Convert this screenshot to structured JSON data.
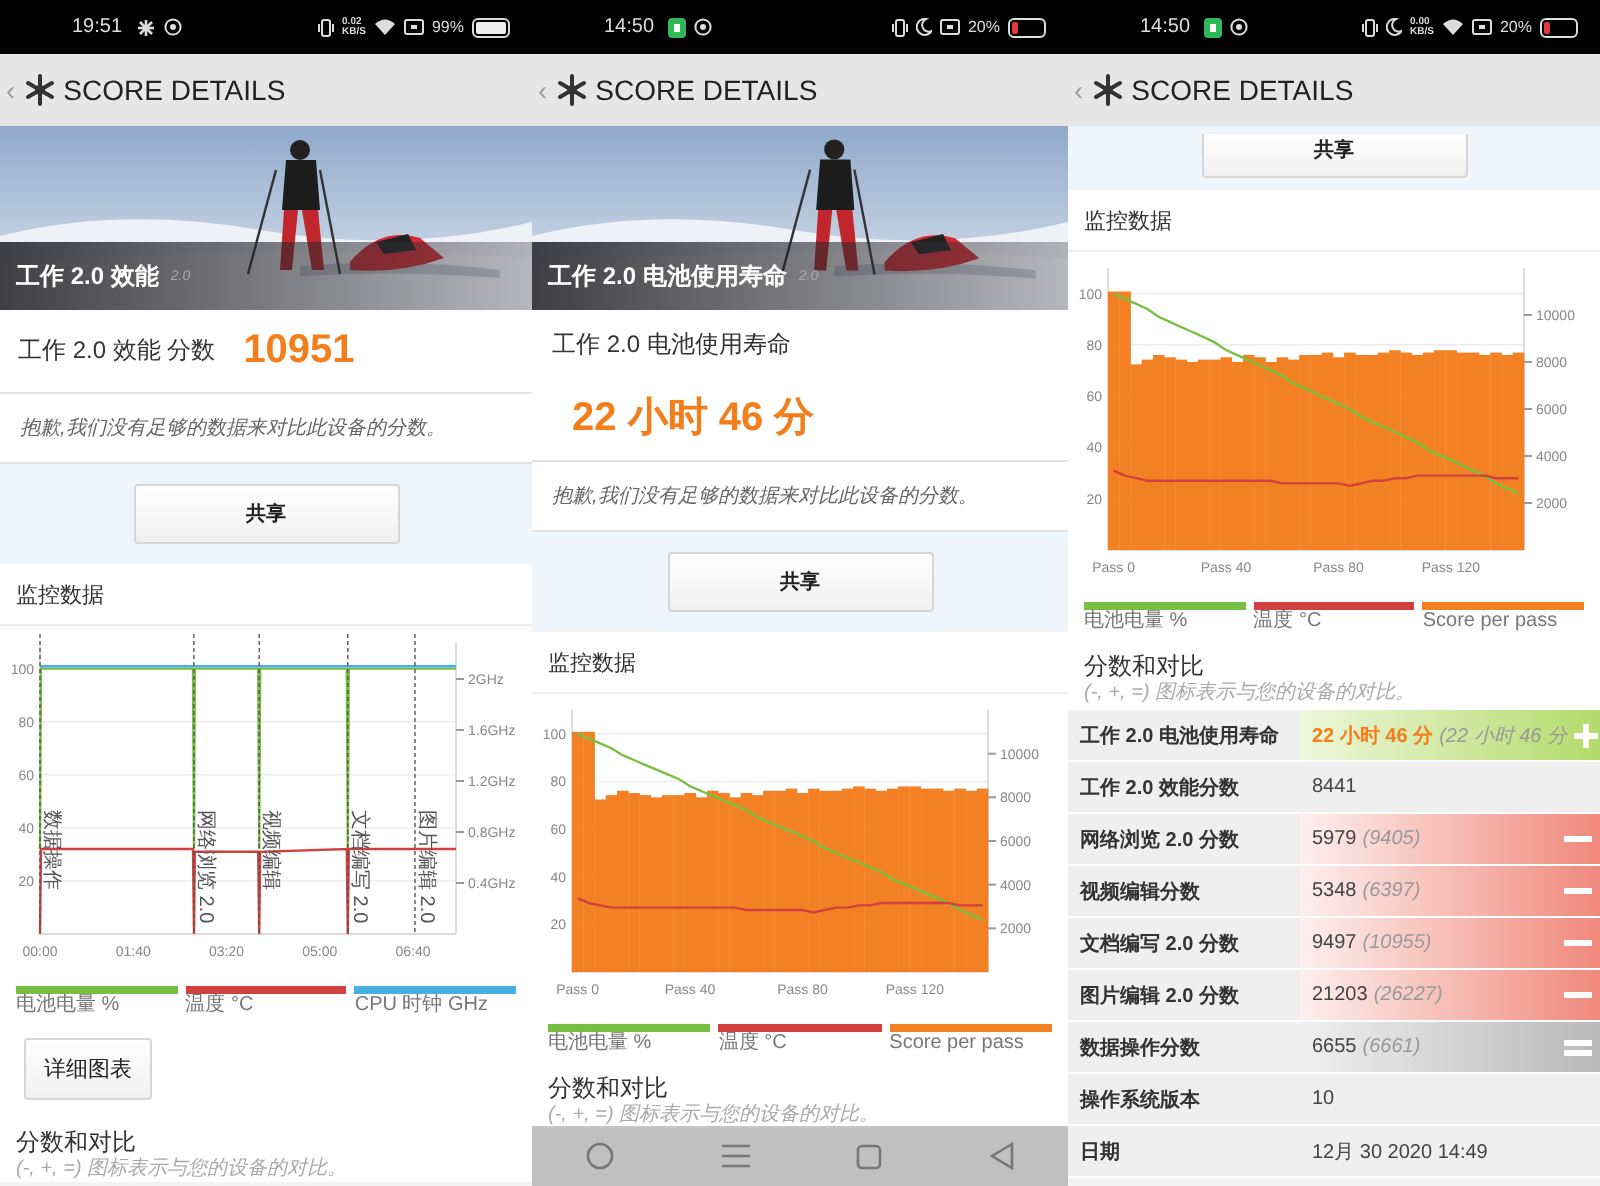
{
  "panels": [
    {
      "status_bar": {
        "time": "19:51",
        "net_speed": {
          "value": "0.02",
          "unit": "KB/S"
        },
        "battery": "99%",
        "battery_low": false,
        "do_not_disturb": false
      },
      "header": {
        "back": "‹",
        "title": "SCORE DETAILS"
      },
      "banner": {
        "title": "工作 2.0 效能",
        "badge": "2.0"
      },
      "score": {
        "kind": "inline",
        "label": "工作 2.0 效能 分数",
        "value": "10951"
      },
      "note": "抱歉,我们没有足够的数据来对比此设备的分数。",
      "share_button": "共享",
      "monitor": {
        "title": "监控数据",
        "chart_data": {
          "type": "line",
          "grid": true,
          "x": [
            0,
            1,
            164,
            165,
            166,
            234,
            235,
            236,
            329,
            330,
            331,
            402,
            446
          ],
          "xlim": [
            0,
            446
          ],
          "ylim": [
            0,
            110
          ],
          "y2lim": [
            0,
            2.29
          ],
          "xticks": [
            {
              "value": 0,
              "label": "00:00"
            },
            {
              "value": 100,
              "label": "01:40"
            },
            {
              "value": 200,
              "label": "03:20"
            },
            {
              "value": 300,
              "label": "05:00"
            },
            {
              "value": 400,
              "label": "06:40"
            }
          ],
          "yticks": [
            20,
            40,
            60,
            80,
            100
          ],
          "y2ticks": [
            {
              "value": 0.4,
              "label": "0.4GHz"
            },
            {
              "value": 0.8,
              "label": "0.8GHz"
            },
            {
              "value": 1.2,
              "label": "1.2GHz"
            },
            {
              "value": 1.6,
              "label": "1.6GHz"
            },
            {
              "value": 2.0,
              "label": "2GHz"
            }
          ],
          "series": [
            {
              "name": "电池电量 %",
              "color": "#78c043",
              "values": [
                32,
                100,
                100,
                32,
                100,
                100,
                32,
                100,
                100,
                32,
                100,
                100,
                100
              ]
            },
            {
              "name": "温度 °C",
              "color": "#d0413e",
              "values": [
                0,
                32,
                32,
                0,
                31,
                31,
                0,
                31,
                32,
                0,
                32,
                32,
                32
              ]
            },
            {
              "name": "CPU 时钟 GHz",
              "color": "#45b0e1",
              "axis": "y2",
              "values": [
                2.1,
                2.1,
                2.1,
                2.1,
                2.1,
                2.1,
                2.1,
                2.1,
                2.1,
                2.1,
                2.1,
                2.1,
                2.1
              ]
            }
          ],
          "ref_lines": [
            {
              "axis": "x",
              "value": 0,
              "label": "数据操作"
            },
            {
              "axis": "x",
              "value": 165,
              "label": "网络浏览 2.0"
            },
            {
              "axis": "x",
              "value": 235,
              "label": "视频编辑"
            },
            {
              "axis": "x",
              "value": 330,
              "label": "文档编写 2.0"
            },
            {
              "axis": "x",
              "value": 402,
              "label": "图片编辑 2.0"
            }
          ]
        }
      },
      "detail_button": "详细图表",
      "comparison": {
        "title": "分数和对比",
        "subtitle": "(-, +, =) 图标表示与您的设备的对比。"
      }
    },
    {
      "status_bar": {
        "time": "14:50",
        "battery": "20%",
        "battery_low": true,
        "do_not_disturb": true
      },
      "header": {
        "back": "‹",
        "title": "SCORE DETAILS"
      },
      "banner": {
        "title": "工作 2.0 电池使用寿命",
        "badge": "2.0"
      },
      "score": {
        "kind": "stacked",
        "label": "工作 2.0 电池使用寿命",
        "value": "22 小时 46 分"
      },
      "note": "抱歉,我们没有足够的数据来对比此设备的分数。",
      "share_button": "共享",
      "monitor": {
        "title": "监控数据",
        "chart_data": {
          "type": "bar",
          "grid": true,
          "categories": [
            "Pass 0",
            null,
            null,
            null,
            null,
            null,
            null,
            null,
            null,
            null,
            "Pass 40",
            null,
            null,
            null,
            null,
            null,
            null,
            null,
            null,
            null,
            "Pass 80",
            null,
            null,
            null,
            null,
            null,
            null,
            null,
            null,
            null,
            "Pass 120",
            null,
            null,
            null,
            null,
            null,
            null
          ],
          "ylim": [
            0,
            110
          ],
          "y2lim": [
            0,
            12000
          ],
          "yticks": [
            20,
            40,
            60,
            80,
            100
          ],
          "y2ticks": [
            2000,
            4000,
            6000,
            8000,
            10000
          ],
          "series": [
            {
              "name": "电池电量 %",
              "color": "#78c043",
              "type": "line",
              "values": [
                100,
                98,
                96,
                94,
                91,
                89,
                87,
                85,
                83,
                81,
                78,
                76,
                74,
                72,
                70,
                68,
                65,
                63,
                61,
                59,
                57,
                55,
                52,
                50,
                48,
                46,
                44,
                42,
                39,
                37,
                35,
                33,
                31,
                29,
                26,
                24,
                22
              ]
            },
            {
              "name": "温度 °C",
              "color": "#d0413e",
              "type": "line",
              "values": [
                31,
                29,
                28,
                27,
                27,
                27,
                27,
                27,
                27,
                27,
                27,
                27,
                27,
                27,
                27,
                26,
                26,
                26,
                26,
                26,
                26,
                25,
                26,
                27,
                27,
                28,
                28,
                29,
                29,
                29,
                29,
                29,
                29,
                29,
                28,
                28,
                28
              ]
            },
            {
              "name": "Score per pass",
              "color": "#f38123",
              "type": "bar",
              "axis": "y2",
              "values": [
                11000,
                11000,
                7900,
                8100,
                8300,
                8200,
                8100,
                8000,
                8100,
                8100,
                8200,
                8000,
                8300,
                8200,
                8000,
                8200,
                8100,
                8300,
                8300,
                8400,
                8200,
                8400,
                8300,
                8300,
                8400,
                8500,
                8400,
                8300,
                8400,
                8500,
                8500,
                8400,
                8400,
                8300,
                8400,
                8300,
                8400
              ]
            }
          ]
        }
      },
      "comparison": {
        "title": "分数和对比",
        "subtitle": "(-, +, =) 图标表示与您的设备的对比。"
      },
      "nav_bar": true
    },
    {
      "status_bar": {
        "time": "14:50",
        "net_speed": {
          "value": "0.00",
          "unit": "KB/S"
        },
        "battery": "20%",
        "battery_low": true,
        "do_not_disturb": true
      },
      "header": {
        "back": "‹",
        "title": "SCORE DETAILS"
      },
      "share_button": "共享",
      "monitor": {
        "title": "监控数据",
        "chart_data": {
          "type": "bar",
          "grid": true,
          "categories": [
            "Pass 0",
            null,
            null,
            null,
            null,
            null,
            null,
            null,
            null,
            null,
            "Pass 40",
            null,
            null,
            null,
            null,
            null,
            null,
            null,
            null,
            null,
            "Pass 80",
            null,
            null,
            null,
            null,
            null,
            null,
            null,
            null,
            null,
            "Pass 120",
            null,
            null,
            null,
            null,
            null,
            null
          ],
          "ylim": [
            0,
            110
          ],
          "y2lim": [
            0,
            12000
          ],
          "yticks": [
            20,
            40,
            60,
            80,
            100
          ],
          "y2ticks": [
            2000,
            4000,
            6000,
            8000,
            10000
          ],
          "series": [
            {
              "name": "电池电量 %",
              "color": "#78c043",
              "type": "line",
              "values": [
                100,
                98,
                96,
                94,
                91,
                89,
                87,
                85,
                83,
                81,
                78,
                76,
                74,
                72,
                70,
                68,
                65,
                63,
                61,
                59,
                57,
                55,
                52,
                50,
                48,
                46,
                44,
                42,
                39,
                37,
                35,
                33,
                31,
                29,
                26,
                24,
                22
              ]
            },
            {
              "name": "温度 °C",
              "color": "#d0413e",
              "type": "line",
              "values": [
                31,
                29,
                28,
                27,
                27,
                27,
                27,
                27,
                27,
                27,
                27,
                27,
                27,
                27,
                27,
                26,
                26,
                26,
                26,
                26,
                26,
                25,
                26,
                27,
                27,
                28,
                28,
                29,
                29,
                29,
                29,
                29,
                29,
                29,
                28,
                28,
                28
              ]
            },
            {
              "name": "Score per pass",
              "color": "#f38123",
              "type": "bar",
              "axis": "y2",
              "values": [
                11000,
                11000,
                7900,
                8100,
                8300,
                8200,
                8100,
                8000,
                8100,
                8100,
                8200,
                8000,
                8300,
                8200,
                8000,
                8200,
                8100,
                8300,
                8300,
                8400,
                8200,
                8400,
                8300,
                8300,
                8400,
                8500,
                8400,
                8300,
                8400,
                8500,
                8500,
                8400,
                8400,
                8300,
                8400,
                8300,
                8400
              ]
            }
          ]
        }
      },
      "comparison": {
        "title": "分数和对比",
        "subtitle": "(-, +, =) 图标表示与您的设备的对比。",
        "rows": [
          {
            "label": "工作 2.0 电池使用寿命",
            "value": "22 小时 46 分",
            "reference": "(22 小时 46 分",
            "kind": "better"
          },
          {
            "label": "工作 2.0 效能分数",
            "value": "8441",
            "kind": "plain"
          },
          {
            "label": "网络浏览 2.0 分数",
            "value": "5979",
            "reference": "(9405)",
            "kind": "worse"
          },
          {
            "label": "视频编辑分数",
            "value": "5348",
            "reference": "(6397)",
            "kind": "worse"
          },
          {
            "label": "文档编写 2.0 分数",
            "value": "9497",
            "reference": "(10955)",
            "kind": "worse"
          },
          {
            "label": "图片编辑 2.0 分数",
            "value": "21203",
            "reference": "(26227)",
            "kind": "worse"
          },
          {
            "label": "数据操作分数",
            "value": "6655",
            "reference": "(6661)",
            "kind": "equal"
          },
          {
            "label": "操作系统版本",
            "value": "10",
            "kind": "plain"
          },
          {
            "label": "日期",
            "value": "12月 30 2020 14:49",
            "kind": "plain"
          }
        ]
      }
    }
  ]
}
